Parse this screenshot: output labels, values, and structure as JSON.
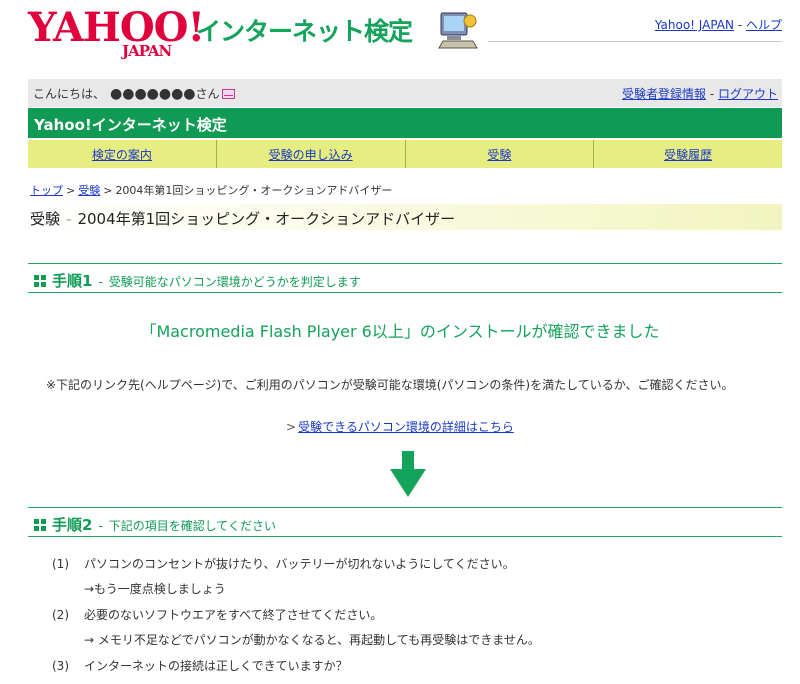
{
  "header": {
    "logo_main": "YAHOO!",
    "logo_sub": "JAPAN",
    "site_title": "インターネット検定",
    "top_link_yahoo": "Yahoo! JAPAN",
    "top_link_sep": "-",
    "top_link_help": "ヘルプ"
  },
  "greeting": {
    "prefix": "こんにちは、",
    "masked_name": "●●●●●●●",
    "suffix": "さん",
    "link_registration": "受験者登録情報",
    "link_sep": "-",
    "link_logout": "ログアウト"
  },
  "bar": {
    "title": "Yahoo!インターネット検定"
  },
  "nav": {
    "items": [
      "検定の案内",
      "受験の申し込み",
      "受験",
      "受験履歴"
    ]
  },
  "breadcrumb": {
    "top": "トップ",
    "exam": "受験",
    "current": "2004年第1回ショッピング・オークションアドバイザー",
    "sep": ">"
  },
  "page_heading": {
    "label": "受験",
    "dash": "-",
    "title": "2004年第1回ショッピング・オークションアドバイザー"
  },
  "step1": {
    "title": "手順1",
    "dash": "-",
    "desc": "受験可能なパソコン環境かどうかを判定します"
  },
  "confirm_message": "「Macromedia Flash Player 6以上」のインストールが確認できました",
  "note": "※下記のリンク先(ヘルプページ)で、ご利用のパソコンが受験可能な環境(パソコンの条件)を満たしているか、ご確認ください。",
  "env_link": {
    "arrow": ">",
    "label": "受験できるパソコン環境の詳細はこちら"
  },
  "step2": {
    "title": "手順2",
    "dash": "-",
    "desc": "下記の項目を確認してください"
  },
  "checklist": [
    {
      "num": "(1)",
      "text": "パソコンのコンセントが抜けたり、バッテリーが切れないようにしてください。",
      "sub": "→もう一度点検しましょう"
    },
    {
      "num": "(2)",
      "text": "必要のないソフトウエアをすべて終了させてください。",
      "sub": "→ メモリ不足などでパソコンが動かなくなると、再起動しても再受験はできません。"
    },
    {
      "num": "(3)",
      "text": "インターネットの接続は正しくできていますか？",
      "sub": ""
    }
  ],
  "colors": {
    "brand_red": "#e0003c",
    "brand_green": "#119a54",
    "nav_yellow": "#e7ee81",
    "link_blue": "#1a39c9"
  },
  "icons": {
    "pc": "computer-icon",
    "mail": "mail-icon",
    "step_bullet": "square-bullets-icon",
    "down": "down-arrow-icon"
  }
}
